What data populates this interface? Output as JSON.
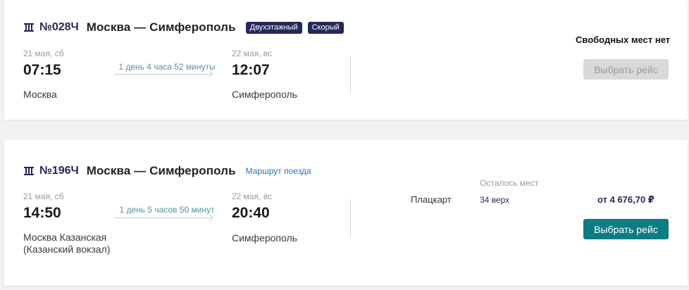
{
  "trains": [
    {
      "number": "№028Ч",
      "route": "Москва — Симферополь",
      "badges": [
        "Двухэтажный",
        "Скорый"
      ],
      "departure": {
        "date": "21 мая, сб",
        "time": "07:15",
        "station": "Москва"
      },
      "duration": "1 день 4 часа 52 минуты",
      "arrival": {
        "date": "22 мая, вс",
        "time": "12:07",
        "station": "Симферополь"
      },
      "availability": "Свободных мест нет",
      "button_label": "Выбрать рейс"
    },
    {
      "number": "№196Ч",
      "route": "Москва — Симферополь",
      "route_link": "Маршрут поезда",
      "departure": {
        "date": "21 мая, сб",
        "time": "14:50",
        "station": "Москва Казанская (Казанский вокзал)"
      },
      "duration": "1 день 5 часов 50 минут",
      "arrival": {
        "date": "22 мая, вс",
        "time": "20:40",
        "station": "Симферополь"
      },
      "seats_header": "Осталось мест",
      "car_type": "Плацкарт",
      "seats": "34 верх",
      "price": "от 4 676,70 ₽",
      "button_label": "Выбрать рейс"
    }
  ],
  "colors": {
    "brand": "#24285b",
    "accent": "#0f7b83",
    "link": "#2f6fc0"
  },
  "icons": {
    "train": "train-icon"
  }
}
